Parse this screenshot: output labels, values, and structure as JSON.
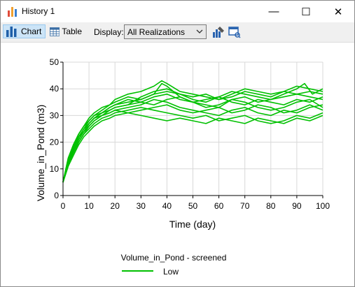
{
  "window": {
    "title": "History 1",
    "minimize_glyph": "—",
    "maximize_glyph": "☐",
    "close_glyph": "✕"
  },
  "toolbar": {
    "chart_label": "Chart",
    "table_label": "Table",
    "display_label": "Display:",
    "display_value": "All Realizations",
    "icons": [
      "bar-chart-icon",
      "table-icon",
      "chart-properties-icon",
      "screen-capture-icon"
    ]
  },
  "colors": {
    "series": "#00c000",
    "grid": "#d8d8d8",
    "axis": "#000000"
  },
  "chart_data": {
    "type": "line",
    "title": "",
    "xlabel": "Time (day)",
    "ylabel": "Volume_in_Pond (m3)",
    "xlim": [
      0,
      100
    ],
    "ylim": [
      0,
      50
    ],
    "xticks": [
      0,
      10,
      20,
      30,
      40,
      50,
      60,
      70,
      80,
      90,
      100
    ],
    "yticks": [
      0,
      10,
      20,
      30,
      40,
      50
    ],
    "grid": true,
    "legend": {
      "title": "Volume_in_Pond - screened",
      "placement": "bottom-center",
      "entries": [
        "Low"
      ]
    },
    "series": [
      {
        "values": [
          [
            0,
            5
          ],
          [
            2,
            13
          ],
          [
            4,
            18
          ],
          [
            6,
            22
          ],
          [
            8,
            25
          ],
          [
            10,
            28
          ],
          [
            12,
            30
          ],
          [
            15,
            31
          ],
          [
            18,
            33
          ],
          [
            20,
            34
          ],
          [
            25,
            35
          ],
          [
            30,
            36
          ],
          [
            35,
            38
          ],
          [
            38,
            42
          ],
          [
            40,
            41
          ],
          [
            45,
            37
          ],
          [
            50,
            35
          ],
          [
            55,
            34
          ],
          [
            60,
            33
          ],
          [
            65,
            36
          ],
          [
            70,
            37
          ],
          [
            75,
            35
          ],
          [
            80,
            36
          ],
          [
            85,
            38
          ],
          [
            90,
            40
          ],
          [
            93,
            42
          ],
          [
            96,
            38
          ],
          [
            100,
            40
          ]
        ]
      },
      {
        "values": [
          [
            0,
            5
          ],
          [
            2,
            12
          ],
          [
            4,
            17
          ],
          [
            6,
            21
          ],
          [
            8,
            24
          ],
          [
            10,
            26
          ],
          [
            12,
            28
          ],
          [
            15,
            30
          ],
          [
            18,
            31
          ],
          [
            20,
            32
          ],
          [
            25,
            33
          ],
          [
            30,
            34
          ],
          [
            35,
            36
          ],
          [
            40,
            35
          ],
          [
            45,
            33
          ],
          [
            50,
            32
          ],
          [
            55,
            31
          ],
          [
            60,
            30
          ],
          [
            65,
            32
          ],
          [
            70,
            33
          ],
          [
            75,
            31
          ],
          [
            80,
            30
          ],
          [
            85,
            32
          ],
          [
            90,
            31
          ],
          [
            95,
            33
          ],
          [
            100,
            34
          ]
        ]
      },
      {
        "values": [
          [
            0,
            5
          ],
          [
            2,
            14
          ],
          [
            4,
            19
          ],
          [
            6,
            23
          ],
          [
            8,
            26
          ],
          [
            10,
            29
          ],
          [
            12,
            31
          ],
          [
            15,
            33
          ],
          [
            18,
            34
          ],
          [
            20,
            36
          ],
          [
            25,
            38
          ],
          [
            30,
            39
          ],
          [
            35,
            41
          ],
          [
            38,
            43
          ],
          [
            40,
            42
          ],
          [
            45,
            39
          ],
          [
            50,
            38
          ],
          [
            55,
            37
          ],
          [
            60,
            36
          ],
          [
            65,
            38
          ],
          [
            70,
            40
          ],
          [
            75,
            39
          ],
          [
            80,
            38
          ],
          [
            85,
            39
          ],
          [
            90,
            41
          ],
          [
            95,
            40
          ],
          [
            100,
            39
          ]
        ]
      },
      {
        "values": [
          [
            0,
            5
          ],
          [
            2,
            11
          ],
          [
            4,
            16
          ],
          [
            6,
            20
          ],
          [
            8,
            23
          ],
          [
            10,
            25
          ],
          [
            12,
            27
          ],
          [
            15,
            29
          ],
          [
            18,
            30
          ],
          [
            20,
            31
          ],
          [
            25,
            32
          ],
          [
            30,
            33
          ],
          [
            35,
            32
          ],
          [
            40,
            31
          ],
          [
            45,
            30
          ],
          [
            50,
            29
          ],
          [
            55,
            30
          ],
          [
            60,
            28
          ],
          [
            65,
            29
          ],
          [
            70,
            30
          ],
          [
            75,
            28
          ],
          [
            80,
            27
          ],
          [
            85,
            28
          ],
          [
            90,
            30
          ],
          [
            95,
            29
          ],
          [
            100,
            31
          ]
        ]
      },
      {
        "values": [
          [
            0,
            5
          ],
          [
            2,
            13
          ],
          [
            4,
            18
          ],
          [
            6,
            22
          ],
          [
            8,
            25
          ],
          [
            10,
            27
          ],
          [
            12,
            29
          ],
          [
            15,
            31
          ],
          [
            18,
            32
          ],
          [
            20,
            33
          ],
          [
            25,
            34
          ],
          [
            30,
            35
          ],
          [
            35,
            37
          ],
          [
            40,
            38
          ],
          [
            45,
            36
          ],
          [
            50,
            35
          ],
          [
            55,
            36
          ],
          [
            60,
            37
          ],
          [
            65,
            35
          ],
          [
            70,
            34
          ],
          [
            75,
            36
          ],
          [
            80,
            35
          ],
          [
            85,
            34
          ],
          [
            90,
            36
          ],
          [
            95,
            35
          ],
          [
            100,
            37
          ]
        ]
      },
      {
        "values": [
          [
            0,
            5
          ],
          [
            2,
            12
          ],
          [
            4,
            17
          ],
          [
            6,
            21
          ],
          [
            8,
            24
          ],
          [
            10,
            27
          ],
          [
            12,
            29
          ],
          [
            15,
            31
          ],
          [
            18,
            33
          ],
          [
            20,
            34
          ],
          [
            25,
            36
          ],
          [
            30,
            35
          ],
          [
            35,
            34
          ],
          [
            40,
            36
          ],
          [
            45,
            37
          ],
          [
            50,
            35
          ],
          [
            55,
            33
          ],
          [
            60,
            34
          ],
          [
            65,
            36
          ],
          [
            70,
            35
          ],
          [
            75,
            33
          ],
          [
            80,
            32
          ],
          [
            85,
            33
          ],
          [
            90,
            35
          ],
          [
            95,
            36
          ],
          [
            100,
            33
          ]
        ]
      },
      {
        "values": [
          [
            0,
            5
          ],
          [
            2,
            14
          ],
          [
            4,
            19
          ],
          [
            6,
            23
          ],
          [
            8,
            26
          ],
          [
            10,
            28
          ],
          [
            12,
            30
          ],
          [
            15,
            32
          ],
          [
            18,
            34
          ],
          [
            20,
            35
          ],
          [
            25,
            37
          ],
          [
            30,
            36
          ],
          [
            35,
            38
          ],
          [
            40,
            39
          ],
          [
            45,
            38
          ],
          [
            50,
            36
          ],
          [
            55,
            35
          ],
          [
            60,
            37
          ],
          [
            65,
            39
          ],
          [
            70,
            38
          ],
          [
            75,
            37
          ],
          [
            80,
            36
          ],
          [
            85,
            37
          ],
          [
            90,
            38
          ],
          [
            95,
            37
          ],
          [
            100,
            36
          ]
        ]
      },
      {
        "values": [
          [
            0,
            5
          ],
          [
            2,
            12
          ],
          [
            4,
            16
          ],
          [
            6,
            20
          ],
          [
            8,
            23
          ],
          [
            10,
            26
          ],
          [
            12,
            28
          ],
          [
            15,
            30
          ],
          [
            18,
            31
          ],
          [
            20,
            32
          ],
          [
            25,
            31
          ],
          [
            30,
            32
          ],
          [
            35,
            33
          ],
          [
            40,
            34
          ],
          [
            45,
            32
          ],
          [
            50,
            31
          ],
          [
            55,
            32
          ],
          [
            60,
            33
          ],
          [
            65,
            31
          ],
          [
            70,
            32
          ],
          [
            75,
            34
          ],
          [
            80,
            33
          ],
          [
            85,
            31
          ],
          [
            90,
            32
          ],
          [
            95,
            34
          ],
          [
            100,
            32
          ]
        ]
      },
      {
        "values": [
          [
            0,
            5
          ],
          [
            2,
            13
          ],
          [
            4,
            18
          ],
          [
            6,
            22
          ],
          [
            8,
            24
          ],
          [
            10,
            27
          ],
          [
            12,
            29
          ],
          [
            15,
            30
          ],
          [
            18,
            32
          ],
          [
            20,
            33
          ],
          [
            25,
            34
          ],
          [
            30,
            37
          ],
          [
            35,
            39
          ],
          [
            40,
            40
          ],
          [
            45,
            38
          ],
          [
            50,
            37
          ],
          [
            55,
            38
          ],
          [
            60,
            36
          ],
          [
            65,
            37
          ],
          [
            70,
            39
          ],
          [
            75,
            38
          ],
          [
            80,
            37
          ],
          [
            85,
            39
          ],
          [
            90,
            38
          ],
          [
            95,
            39
          ],
          [
            100,
            38
          ]
        ]
      },
      {
        "values": [
          [
            0,
            5
          ],
          [
            2,
            11
          ],
          [
            4,
            15
          ],
          [
            6,
            19
          ],
          [
            8,
            22
          ],
          [
            10,
            24
          ],
          [
            12,
            26
          ],
          [
            15,
            28
          ],
          [
            18,
            29
          ],
          [
            20,
            30
          ],
          [
            25,
            31
          ],
          [
            30,
            30
          ],
          [
            35,
            29
          ],
          [
            40,
            28
          ],
          [
            45,
            29
          ],
          [
            50,
            28
          ],
          [
            55,
            27
          ],
          [
            60,
            29
          ],
          [
            65,
            28
          ],
          [
            70,
            27
          ],
          [
            75,
            29
          ],
          [
            80,
            28
          ],
          [
            85,
            27
          ],
          [
            90,
            29
          ],
          [
            95,
            28
          ],
          [
            100,
            30
          ]
        ]
      }
    ]
  }
}
